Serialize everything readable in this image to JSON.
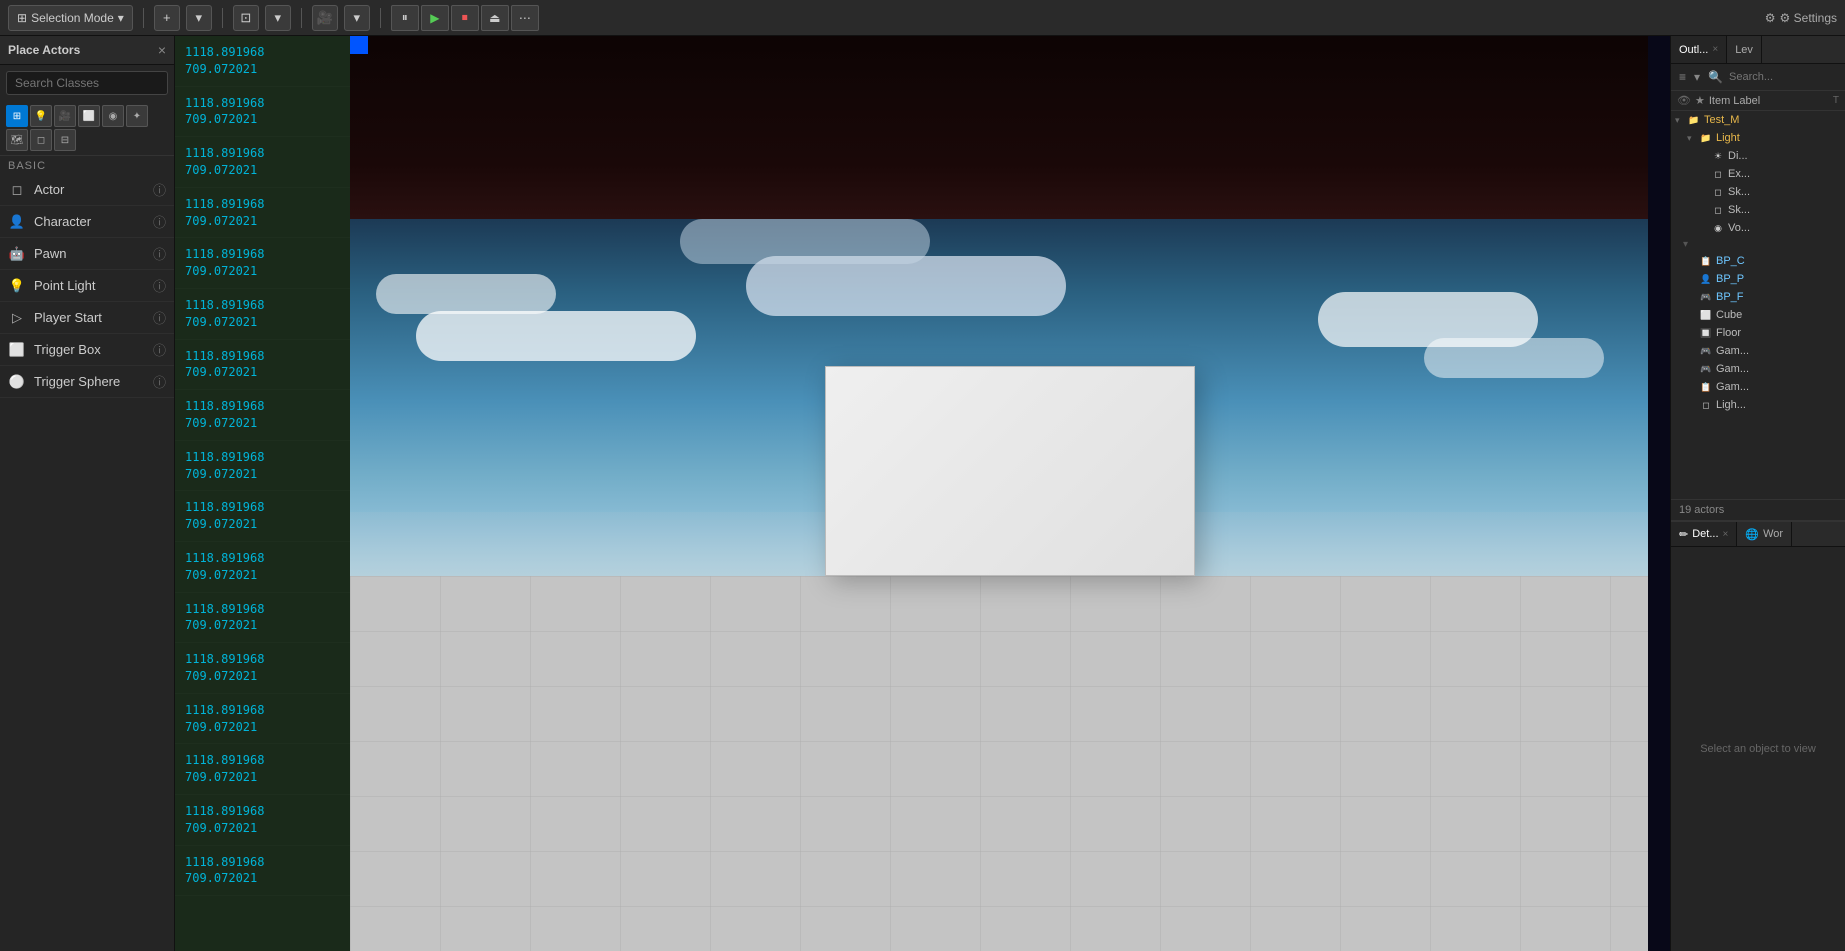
{
  "toolbar": {
    "mode_label": "Selection Mode",
    "mode_dropdown": "▾",
    "settings_label": "⚙ Settings"
  },
  "left_panel": {
    "title": "Place Actors",
    "close": "×",
    "search_placeholder": "Search Classes",
    "basic_label": "BASIC",
    "actors": [
      {
        "name": "Actor",
        "icon": "◻"
      },
      {
        "name": "Character",
        "icon": "👤"
      },
      {
        "name": "Pawn",
        "icon": "🤖"
      },
      {
        "name": "Point Light",
        "icon": "💡"
      },
      {
        "name": "Player Start",
        "icon": "▷"
      },
      {
        "name": "Trigger Box",
        "icon": "⬜"
      },
      {
        "name": "Trigger Sphere",
        "icon": "⚪"
      }
    ]
  },
  "viewport": {
    "coordinates": [
      "1118.891968\n709.072021",
      "1118.891968\n709.072021",
      "1118.891968\n709.072021",
      "1118.891968\n709.072021",
      "1118.891968\n709.072021",
      "1118.891968\n709.072021",
      "1118.891968\n709.072021",
      "1118.891968\n709.072021",
      "1118.891968\n709.072021",
      "1118.891968\n709.072021",
      "1118.891968\n709.072021",
      "1118.891968\n709.072021",
      "1118.891968\n709.072021",
      "1118.891968\n709.072021",
      "1118.891968\n709.072021",
      "1118.891968\n709.072021",
      "1118.891968\n709.072021"
    ]
  },
  "right_panel": {
    "tabs": [
      {
        "label": "Outl...",
        "active": true
      },
      {
        "label": "Lev",
        "active": false
      }
    ],
    "col_label": "Item Label",
    "col_extra": "T",
    "tree": [
      {
        "indent": 0,
        "expand": "▾",
        "icon": "🗂",
        "label": "Test_M",
        "type": "folder"
      },
      {
        "indent": 1,
        "expand": "▾",
        "icon": "🗂",
        "label": "Light",
        "type": "folder"
      },
      {
        "indent": 2,
        "expand": "",
        "icon": "☀",
        "label": "Di...",
        "type": "normal"
      },
      {
        "indent": 2,
        "expand": "",
        "icon": "◻",
        "label": "Ex...",
        "type": "normal"
      },
      {
        "indent": 2,
        "expand": "",
        "icon": "◻",
        "label": "Sk...",
        "type": "normal"
      },
      {
        "indent": 2,
        "expand": "",
        "icon": "◻",
        "label": "Sk...",
        "type": "normal"
      },
      {
        "indent": 2,
        "expand": "",
        "icon": "◻",
        "label": "Vo...",
        "type": "normal"
      },
      {
        "indent": 1,
        "expand": "",
        "icon": "📋",
        "label": "BP_C",
        "type": "blueprint"
      },
      {
        "indent": 1,
        "expand": "",
        "icon": "👤",
        "label": "BP_P",
        "type": "blueprint"
      },
      {
        "indent": 1,
        "expand": "",
        "icon": "🎮",
        "label": "BP_F",
        "type": "blueprint"
      },
      {
        "indent": 1,
        "expand": "",
        "icon": "⬜",
        "label": "Cube",
        "type": "normal"
      },
      {
        "indent": 1,
        "expand": "",
        "icon": "🔲",
        "label": "Floor",
        "type": "normal"
      },
      {
        "indent": 1,
        "expand": "",
        "icon": "🎮",
        "label": "Gam...",
        "type": "normal"
      },
      {
        "indent": 1,
        "expand": "",
        "icon": "🎮",
        "label": "Gam...",
        "type": "normal"
      },
      {
        "indent": 1,
        "expand": "",
        "icon": "📋",
        "label": "Gam...",
        "type": "normal"
      },
      {
        "indent": 1,
        "expand": "",
        "icon": "◻",
        "label": "Ligh...",
        "type": "normal"
      }
    ],
    "actors_count": "19 actors",
    "bottom_tabs": [
      {
        "label": "Det...",
        "active": true
      },
      {
        "label": "Wor",
        "active": false
      }
    ],
    "select_hint": "Select an object to view"
  }
}
